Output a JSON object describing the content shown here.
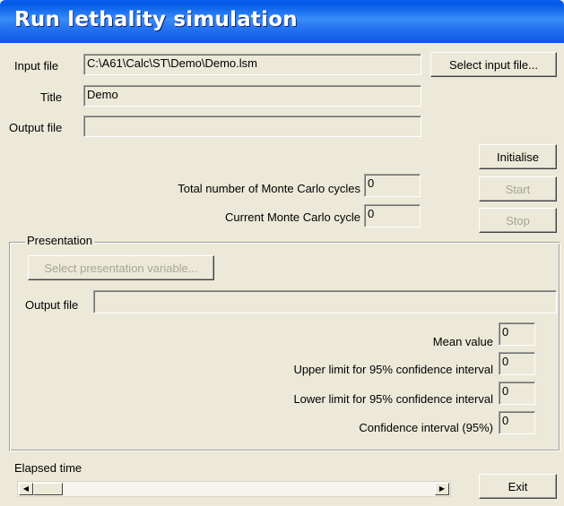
{
  "window": {
    "title": "Run lethality simulation"
  },
  "form": {
    "input_file_label": "Input file",
    "input_file_value": "C:\\A61\\Calc\\ST\\Demo\\Demo.lsm",
    "select_input_button": "Select input file...",
    "title_label": "Title",
    "title_value": "Demo",
    "output_file_label": "Output file",
    "output_file_value": ""
  },
  "simulation": {
    "total_cycles_label": "Total number of Monte Carlo cycles",
    "total_cycles_value": "0",
    "current_cycle_label": "Current Monte Carlo cycle",
    "current_cycle_value": "0",
    "initialise_button": "Initialise",
    "start_button": "Start",
    "stop_button": "Stop"
  },
  "presentation": {
    "group_title": "Presentation",
    "select_variable_button": "Select presentation variable...",
    "output_file_label": "Output file",
    "output_file_value": "",
    "mean_label": "Mean value",
    "mean_value": "0",
    "upper_label": "Upper limit for 95% confidence interval",
    "upper_value": "0",
    "lower_label": "Lower limit for 95% confidence interval",
    "lower_value": "0",
    "ci_label": "Confidence interval (95%)",
    "ci_value": "0"
  },
  "footer": {
    "elapsed_label": "Elapsed time",
    "exit_button": "Exit",
    "left_arrow": "◀",
    "right_arrow": "▶"
  }
}
